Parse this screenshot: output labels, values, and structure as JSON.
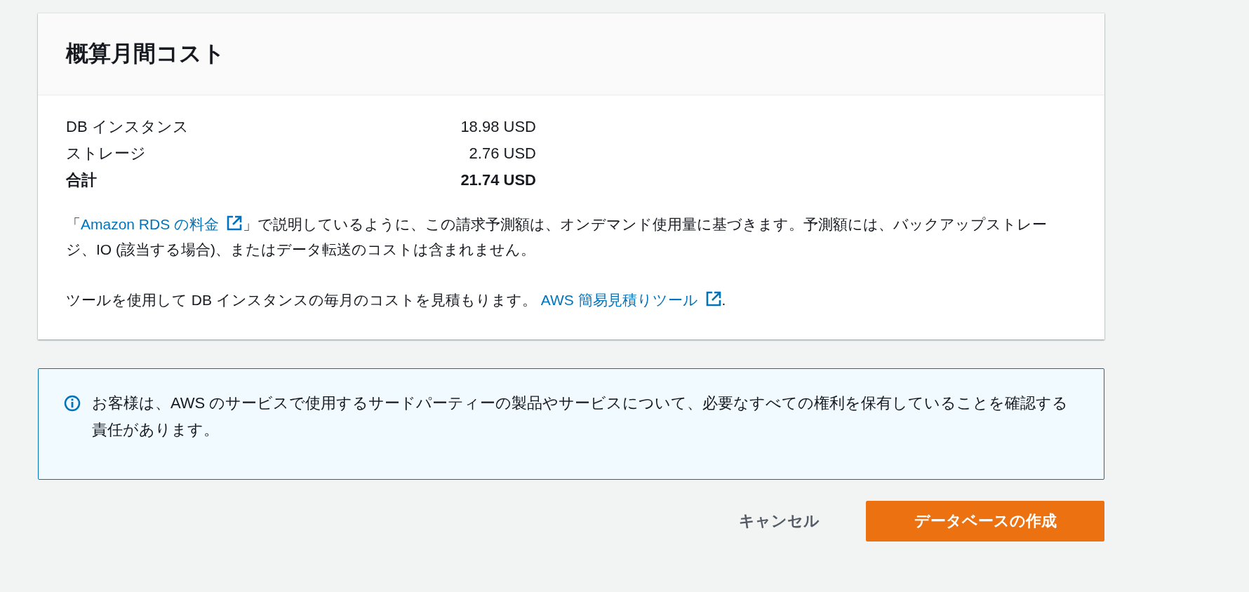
{
  "cost_panel": {
    "title": "概算月間コスト",
    "rows": [
      {
        "label": "DB インスタンス",
        "value": "18.98 USD",
        "kind": "item"
      },
      {
        "label": "ストレージ",
        "value": "2.76 USD",
        "kind": "item"
      },
      {
        "label": "合計",
        "value": "21.74 USD",
        "kind": "total"
      }
    ],
    "paragraphs": [
      {
        "before": "「",
        "link": "Amazon RDS の料金",
        "after": "」で説明しているように、この請求予測額は、オンデマンド使用量に基づきます。予測額には、バックアップストレージ、IO (該当する場合)、またはデータ転送のコストは含まれません。"
      },
      {
        "before": "ツールを使用して DB インスタンスの毎月のコストを見積もります。 ",
        "link": "AWS 簡易見積りツール",
        "after": "."
      }
    ]
  },
  "info_alert": {
    "text": "お客様は、AWS のサービスで使用するサードパーティーの製品やサービスについて、必要なすべての権利を保有していることを確認する責任があります。"
  },
  "buttons": [
    {
      "label": "キャンセル",
      "kind": "link"
    },
    {
      "label": "データベースの作成",
      "kind": "primary"
    }
  ]
}
